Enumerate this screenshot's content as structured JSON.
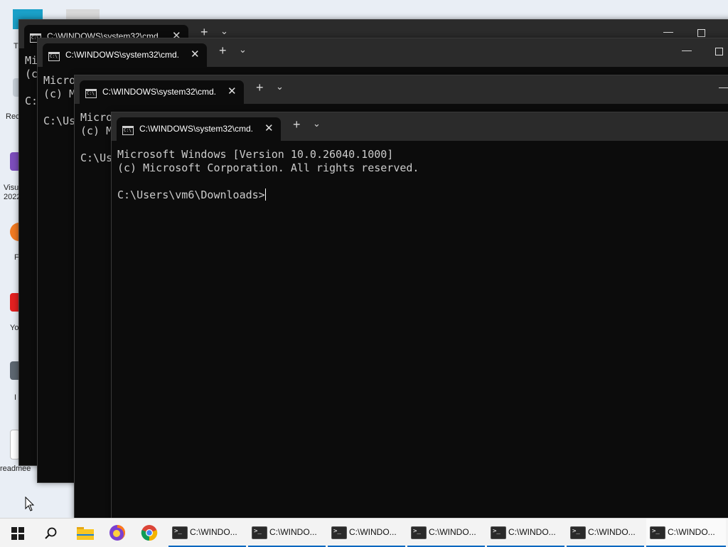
{
  "desktop": {
    "icons": [
      {
        "label": "T"
      },
      {
        "label": "Rec"
      },
      {
        "label": "Visu 2022"
      },
      {
        "label": "F"
      },
      {
        "label": "Yo"
      },
      {
        "label": "I"
      },
      {
        "label": "readmee"
      }
    ]
  },
  "windows": [
    {
      "tab_title": "C:\\WINDOWS\\system32\\cmd.",
      "lines": [
        "Mi",
        "(c",
        "",
        "C:"
      ]
    },
    {
      "tab_title": "C:\\WINDOWS\\system32\\cmd.",
      "lines": [
        "Micro",
        "(c) M",
        "",
        "C:\\Us"
      ]
    },
    {
      "tab_title": "C:\\WINDOWS\\system32\\cmd.",
      "lines": [
        "Micro",
        "(c) M",
        "",
        "C:\\Us"
      ]
    },
    {
      "tab_title": "C:\\WINDOWS\\system32\\cmd.",
      "lines": [
        "Microsoft Windows [Version 10.0.26040.1000]",
        "(c) Microsoft Corporation. All rights reserved.",
        "",
        "C:\\Users\\vm6\\Downloads>"
      ]
    }
  ],
  "taskbar": {
    "tasks": [
      {
        "label": "C:\\WINDO..."
      },
      {
        "label": "C:\\WINDO..."
      },
      {
        "label": "C:\\WINDO..."
      },
      {
        "label": "C:\\WINDO..."
      },
      {
        "label": "C:\\WINDO..."
      },
      {
        "label": "C:\\WINDO..."
      },
      {
        "label": "C:\\WINDO..."
      }
    ]
  },
  "colors": {
    "terminal_bg": "#0c0c0c",
    "terminal_text": "#cccccc",
    "titlebar": "#2b2b2b",
    "taskbar": "#f3f3f3",
    "accent": "#0067c0"
  },
  "icons": [
    "cmd-icon",
    "close-icon",
    "plus-icon",
    "chevron-down-icon",
    "minimize-icon",
    "maximize-icon",
    "windows-start-icon",
    "search-icon",
    "file-explorer-icon",
    "firefox-icon",
    "chrome-icon",
    "terminal-icon",
    "mouse-cursor-icon"
  ]
}
